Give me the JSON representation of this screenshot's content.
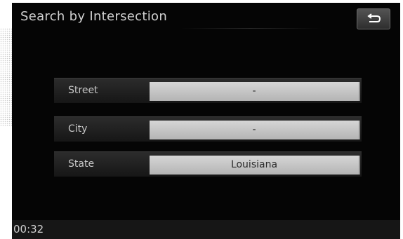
{
  "header": {
    "title": "Search by Intersection",
    "back_icon": "back-arrow-icon"
  },
  "fields": {
    "street": {
      "label": "Street",
      "value": "-"
    },
    "city": {
      "label": "City",
      "value": "-"
    },
    "state": {
      "label": "State",
      "value": "Louisiana"
    }
  },
  "status_bar": {
    "time": "00:32"
  }
}
